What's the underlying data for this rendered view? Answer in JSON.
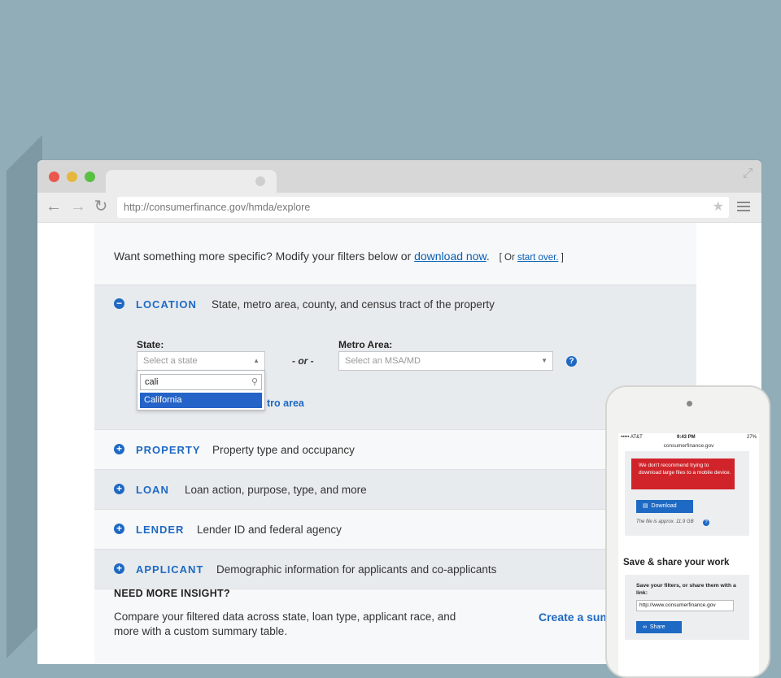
{
  "browser": {
    "url": "http://consumerfinance.gov/hmda/explore"
  },
  "intro": {
    "text": "Want something more specific? Modify your filters below or ",
    "download_link": "download now",
    "period": ".",
    "bracket_open": "[ Or ",
    "start_over_link": "start over.",
    "bracket_close": " ]"
  },
  "location": {
    "icon": "minus-circle",
    "title": "LOCATION",
    "description": "State, metro area, county, and census tract of the property",
    "state_label": "State:",
    "state_placeholder": "Select a state",
    "or_text": "- or -",
    "metro_label": "Metro Area:",
    "metro_placeholder": "Select an MSA/MD",
    "search_value": "cali",
    "option": "California",
    "metro_link_partial": "tro area"
  },
  "sections": [
    {
      "icon": "plus-circle",
      "title": "PROPERTY",
      "description": "Property type and occupancy"
    },
    {
      "icon": "plus-circle",
      "title": "LOAN",
      "description": "Loan action, purpose, type, and more"
    },
    {
      "icon": "plus-circle",
      "title": "LENDER",
      "description": "Lender ID and federal agency"
    },
    {
      "icon": "plus-circle",
      "title": "APPLICANT",
      "description": "Demographic information for applicants and co-applicants"
    }
  ],
  "insight": {
    "title": "NEED MORE INSIGHT?",
    "desc_line1": "Compare your filtered data across state, loan type, applicant race, and",
    "desc_line2": "more with a custom summary table.",
    "create_link": "Create a sum"
  },
  "phone": {
    "carrier": "••••• AT&T",
    "time": "9:43 PM",
    "battery": "27%",
    "site": "consumerfinance.gov",
    "alert": "We don't recommend trying to download large files to a mobile device.",
    "download_label": "Download",
    "file_size": "The file is approx. 11.9 GB",
    "save_title": "Save & share your work",
    "save_desc": "Save your filters, or share them with a link:",
    "link_value": "http://www.consumerfinance.gov",
    "share_label": "Share"
  },
  "colors": {
    "background": "#91adb8",
    "accent": "#1e69c3",
    "alert": "#d0242a",
    "selected_option": "#2463c7"
  }
}
